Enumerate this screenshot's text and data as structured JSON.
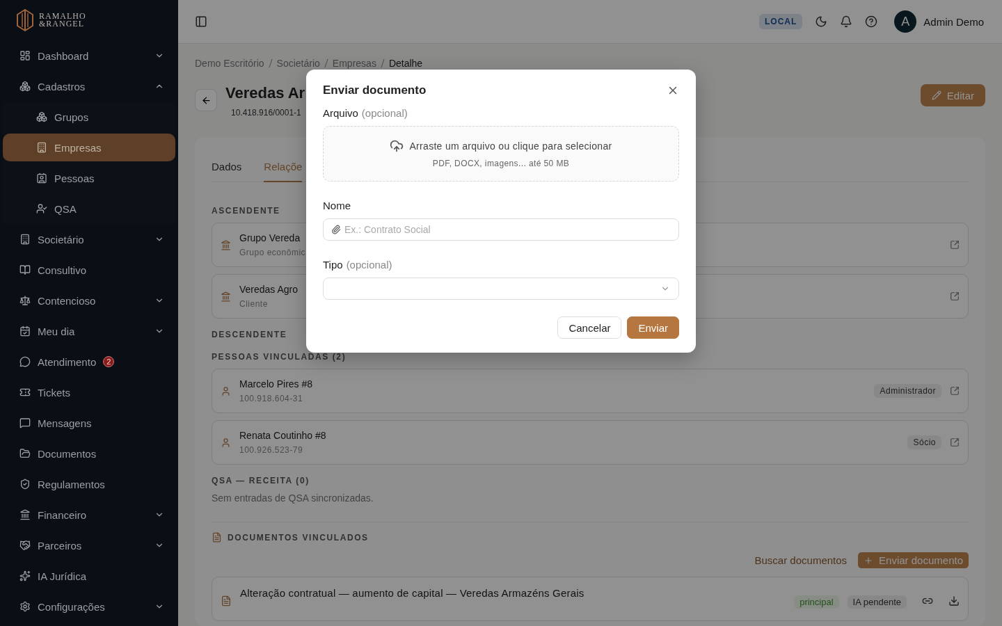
{
  "sidebar": {
    "logo": {
      "name_top": "RAMALHO",
      "name_bottom": "&RANGEL"
    },
    "items": [
      {
        "label": "Dashboard",
        "expanded": false,
        "selected": false
      },
      {
        "label": "Cadastros",
        "expanded": true,
        "selected": false,
        "children": [
          {
            "label": "Grupos",
            "selected": false
          },
          {
            "label": "Empresas",
            "selected": true
          },
          {
            "label": "Pessoas",
            "selected": false
          },
          {
            "label": "QSA",
            "selected": false
          }
        ]
      },
      {
        "label": "Societário",
        "expanded": false,
        "selected": false
      },
      {
        "label": "Consultivo",
        "selected": false
      },
      {
        "label": "Contencioso",
        "expanded": false,
        "selected": false
      },
      {
        "label": "Meu dia",
        "expanded": false,
        "selected": false
      },
      {
        "label": "Atendimento",
        "badge": "2",
        "selected": false
      },
      {
        "label": "Tickets",
        "selected": false
      },
      {
        "label": "Mensagens",
        "selected": false
      },
      {
        "label": "Documentos",
        "selected": false
      },
      {
        "label": "Regulamentos",
        "selected": false
      },
      {
        "label": "Financeiro",
        "expanded": false,
        "selected": false
      },
      {
        "label": "Parceiros",
        "expanded": false,
        "selected": false
      },
      {
        "label": "IA Jurídica",
        "selected": false
      },
      {
        "label": "Configurações",
        "expanded": false,
        "selected": false
      }
    ]
  },
  "header": {
    "env_badge": "LOCAL",
    "user": {
      "initial": "A",
      "name": "Admin Demo"
    }
  },
  "page": {
    "breadcrumb": [
      "Demo Escritório",
      "Societário",
      "Empresas",
      "Detalhe"
    ],
    "title": "Veredas Ar",
    "subtitle": "10.418.916/0001-1",
    "edit_button": "Editar"
  },
  "tabs": [
    {
      "label": "Dados",
      "selected": false
    },
    {
      "label": "Relaçõe",
      "selected": true
    }
  ],
  "ascendente": {
    "heading": "ASCENDENTE",
    "items": [
      {
        "name": "Grupo Vereda",
        "detail": "Grupo econômic"
      },
      {
        "name": "Veredas Agro",
        "detail": "Cliente"
      }
    ]
  },
  "descendente": {
    "heading": "DESCENDENTE"
  },
  "people": {
    "heading": "PESSOAS VINCULADAS (2)",
    "items": [
      {
        "name": "Marcelo Pires #8",
        "document": "100.918.604-31",
        "role": "Administrador"
      },
      {
        "name": "Renata Coutinho #8",
        "document": "100.926.523-79",
        "role": "Sócio"
      }
    ]
  },
  "qsa": {
    "heading": "QSA — RECEITA (0)",
    "empty_text": "Sem entradas de QSA sincronizadas."
  },
  "documents": {
    "heading": "DOCUMENTOS VINCULADOS",
    "search_link": "Buscar documentos",
    "upload_button": "Enviar documento",
    "items": [
      {
        "title": "Alteração contratual — aumento de capital — Veredas Armazéns Gerais",
        "badges": [
          {
            "label": "principal",
            "kind": "primary"
          },
          {
            "label": "IA pendente",
            "kind": "status"
          }
        ]
      }
    ]
  },
  "modal": {
    "title": "Enviar documento",
    "file_field": {
      "label": "Arquivo",
      "hint": "(opcional)",
      "drop_text": "Arraste um arquivo ou clique para selecionar",
      "drop_note": "PDF, DOCX, imagens... até 50 MB"
    },
    "name_field": {
      "label": "Nome",
      "placeholder": "Ex.: Contrato Social"
    },
    "type_field": {
      "label": "Tipo",
      "hint": "(opcional)"
    },
    "buttons": [
      {
        "label": "Cancelar",
        "kind": "secondary"
      },
      {
        "label": "Enviar",
        "kind": "primary"
      }
    ]
  }
}
